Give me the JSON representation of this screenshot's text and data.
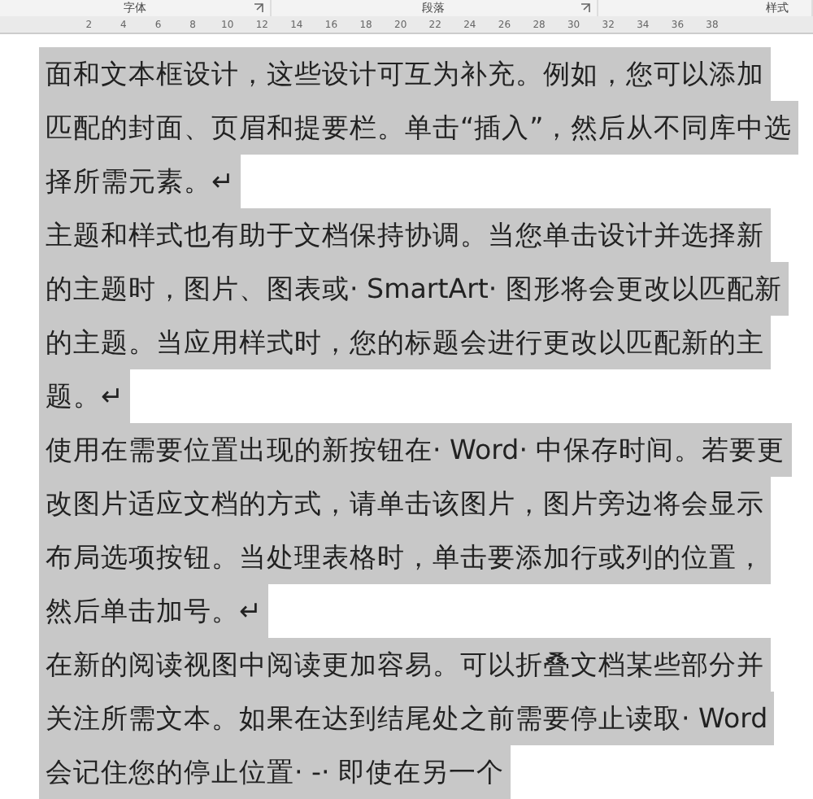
{
  "ribbon_groups": [
    {
      "label": "字体"
    },
    {
      "label": "段落"
    },
    {
      "label": "样式"
    }
  ],
  "ruler": {
    "numbers": [
      "2",
      "4",
      "6",
      "8",
      "10",
      "12",
      "14",
      "16",
      "18",
      "20",
      "22",
      "24",
      "26",
      "28",
      "30",
      "32",
      "34",
      "36",
      "38"
    ]
  },
  "paragraphs": [
    {
      "selected": true,
      "lines": [
        "面和文本框设计，这些设计可互为补充。例如，您可以添加",
        "匹配的封面、页眉和提要栏。单击“插入”，然后从不同库中选",
        "择所需元素。↵"
      ]
    },
    {
      "selected": true,
      "lines": [
        "主题和样式也有助于文档保持协调。当您单击设计并选择新",
        "的主题时，图片、图表或· SmartArt· 图形将会更改以匹配新",
        "的主题。当应用样式时，您的标题会进行更改以匹配新的主",
        "题。↵"
      ]
    },
    {
      "selected": true,
      "lines": [
        "使用在需要位置出现的新按钮在· Word· 中保存时间。若要更",
        "改图片适应文档的方式，请单击该图片，图片旁边将会显示",
        "布局选项按钮。当处理表格时，单击要添加行或列的位置，",
        "然后单击加号。↵"
      ]
    },
    {
      "selected": true,
      "lines": [
        "在新的阅读视图中阅读更加容易。可以折叠文档某些部分并",
        "关注所需文本。如果在达到结尾处之前需要停止读取· Word",
        "会记住您的停止位置· -· 即使在另一个"
      ]
    }
  ]
}
